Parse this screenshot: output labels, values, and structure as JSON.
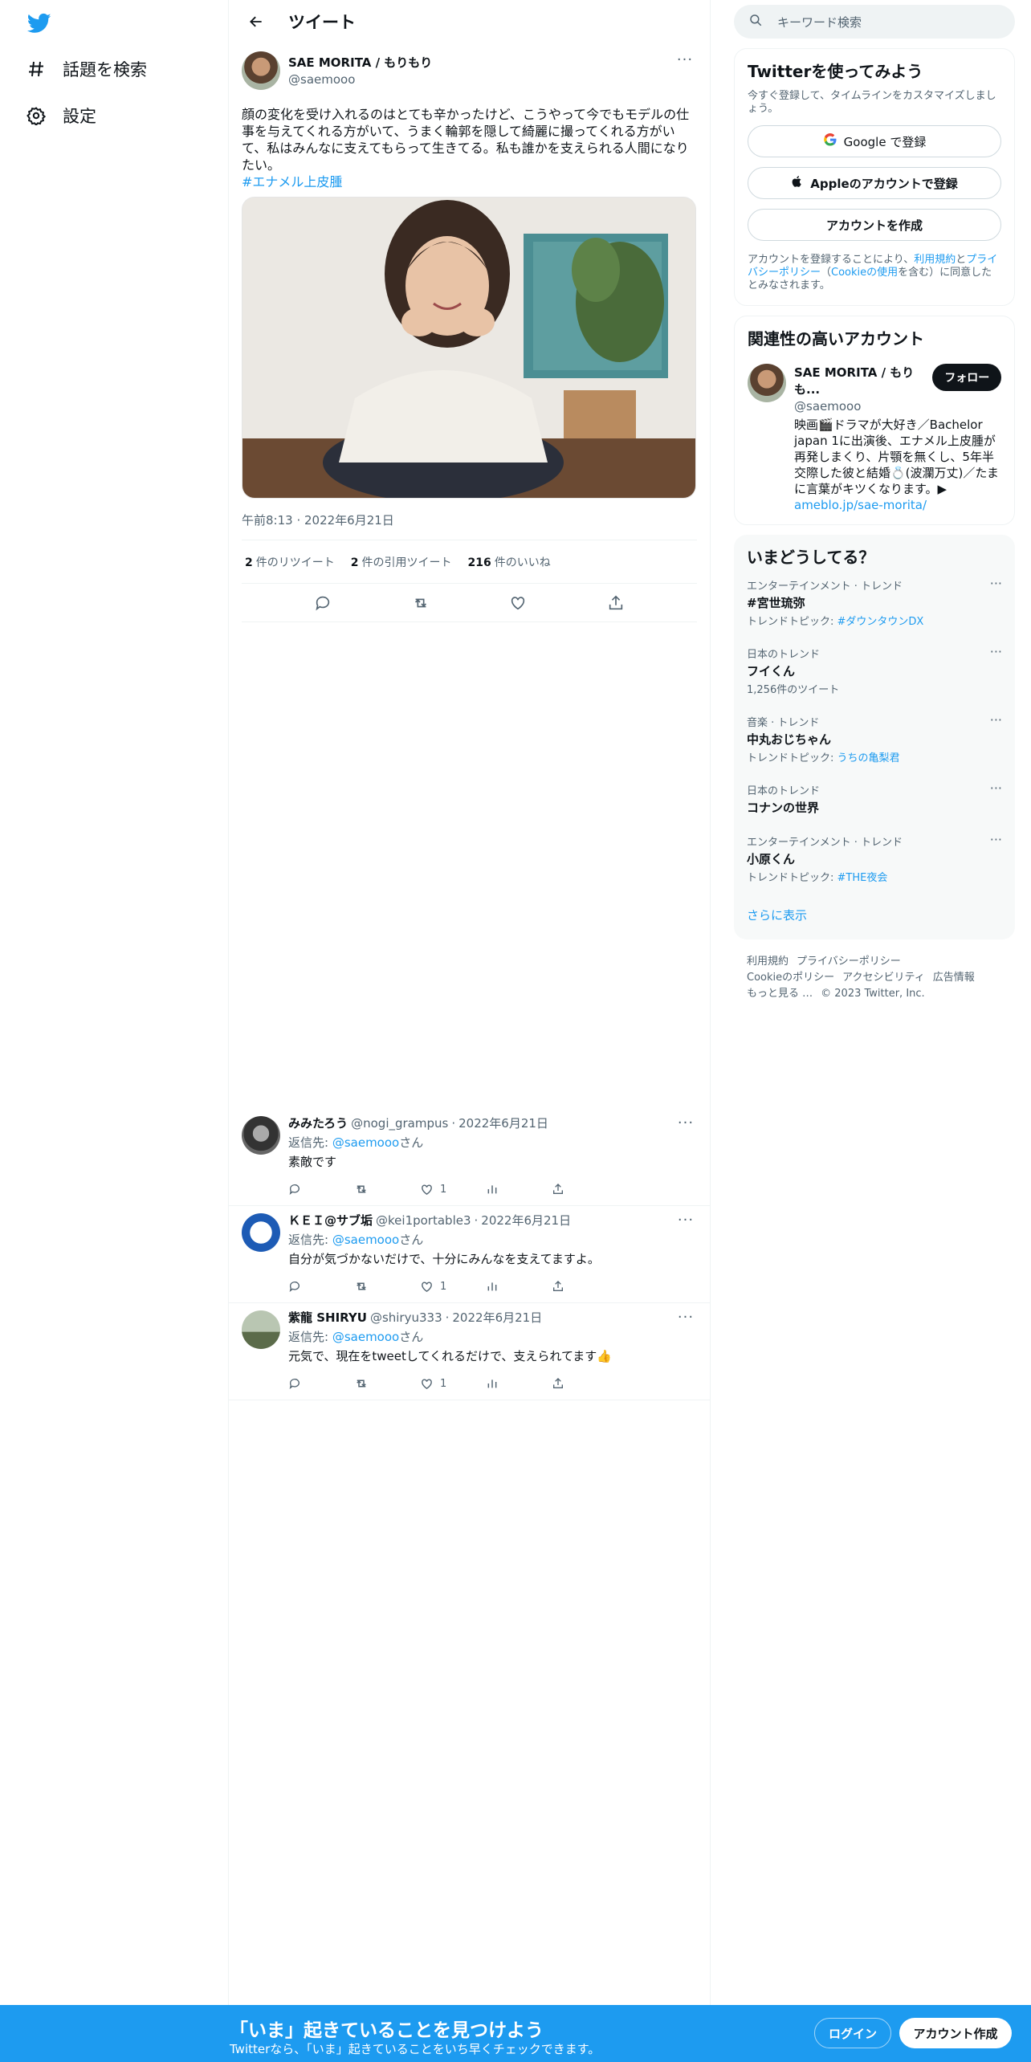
{
  "nav": {
    "explore_label": "話題を検索",
    "settings_label": "設定"
  },
  "header": {
    "title": "ツイート"
  },
  "tweet": {
    "author_name": "SAE MORITA / もりもり",
    "author_handle": "@saemooo",
    "text": "顔の変化を受け入れるのはとても辛かったけど、こうやって今でもモデルの仕事を与えてくれる方がいて、うまく輪郭を隠して綺麗に撮ってくれる方がいて、私はみんなに支えてもらって生きてる。私も誰かを支えられる人間になりたい。",
    "hashtag": "#エナメル上皮腫",
    "timestamp": "午前8:13 · 2022年6月21日",
    "retweets_count": "2",
    "retweets_label": "件のリツイート",
    "quotes_count": "2",
    "quotes_label": "件の引用ツイート",
    "likes_count": "216",
    "likes_label": "件のいいね"
  },
  "replies": [
    {
      "name": "みみたろう",
      "handle": "@nogi_grampus",
      "date": "2022年6月21日",
      "reply_to_prefix": "返信先: ",
      "reply_to": "@saemooo",
      "reply_to_suffix": "さん",
      "text": "素敵です",
      "likes": "1"
    },
    {
      "name": "ＫＥＩ@サブ垢",
      "handle": "@kei1portable3",
      "date": "2022年6月21日",
      "reply_to_prefix": "返信先: ",
      "reply_to": "@saemooo",
      "reply_to_suffix": "さん",
      "text": "自分が気づかないだけで、十分にみんなを支えてますよ。",
      "likes": "1"
    },
    {
      "name": "紫龍 SHIRYU",
      "handle": "@shiryu333",
      "date": "2022年6月21日",
      "reply_to_prefix": "返信先: ",
      "reply_to": "@saemooo",
      "reply_to_suffix": "さん",
      "text": "元気で、現在をtweetしてくれるだけで、支えられてます👍",
      "likes": "1"
    }
  ],
  "search": {
    "placeholder": "キーワード検索"
  },
  "signup": {
    "title": "Twitterを使ってみよう",
    "subtitle": "今すぐ登録して、タイムラインをカスタマイズしましょう。",
    "google_label": "Google で登録",
    "apple_label": "Appleのアカウントで登録",
    "create_label": "アカウントを作成",
    "legal_1": "アカウントを登録することにより、",
    "legal_terms": "利用規約",
    "legal_2": "と",
    "legal_privacy": "プライバシーポリシー",
    "legal_3": "（",
    "legal_cookie": "Cookieの使用",
    "legal_4": "を含む）に同意したとみなされます。"
  },
  "related": {
    "title": "関連性の高いアカウント",
    "name": "SAE MORITA / もりも...",
    "handle": "@saemooo",
    "follow_label": "フォロー",
    "bio": "映画🎬ドラマが大好き／Bachelor japan 1に出演後、エナメル上皮腫が再発しまくり、片顎を無くし、5年半交際した彼と結婚💍(波瀾万丈)／たまに言葉がキツくなります。▶",
    "bio_link": "ameblo.jp/sae-morita/"
  },
  "trends": {
    "title": "いまどうしてる？",
    "items": [
      {
        "category": "エンターテインメント · トレンド",
        "name": "#宮世琉弥",
        "sub_prefix": "トレンドトピック: ",
        "sub_link": "#ダウンタウンDX",
        "sub_text": ""
      },
      {
        "category": "日本のトレンド",
        "name": "フイくん",
        "sub_prefix": "",
        "sub_link": "",
        "sub_text": "1,256件のツイート"
      },
      {
        "category": "音楽 · トレンド",
        "name": "中丸おじちゃん",
        "sub_prefix": "トレンドトピック: ",
        "sub_link": "うちの亀梨君",
        "sub_text": ""
      },
      {
        "category": "日本のトレンド",
        "name": "コナンの世界",
        "sub_prefix": "",
        "sub_link": "",
        "sub_text": ""
      },
      {
        "category": "エンターテインメント · トレンド",
        "name": "小原くん",
        "sub_prefix": "トレンドトピック: ",
        "sub_link": "#THE夜会",
        "sub_text": ""
      }
    ],
    "show_more": "さらに表示"
  },
  "footer": {
    "terms": "利用規約",
    "privacy": "プライバシーポリシー",
    "cookie": "Cookieのポリシー",
    "accessibility": "アクセシビリティ",
    "ads": "広告情報",
    "more": "もっと見る …",
    "copyright": "© 2023 Twitter, Inc."
  },
  "bottombar": {
    "title": "「いま」起きていることを見つけよう",
    "subtitle": "Twitterなら、「いま」起きていることをいち早くチェックできます。",
    "login_label": "ログイン",
    "signup_label": "アカウント作成"
  },
  "colors": {
    "accent": "#1d9bf0",
    "text": "#0f1419",
    "muted": "#536471"
  }
}
